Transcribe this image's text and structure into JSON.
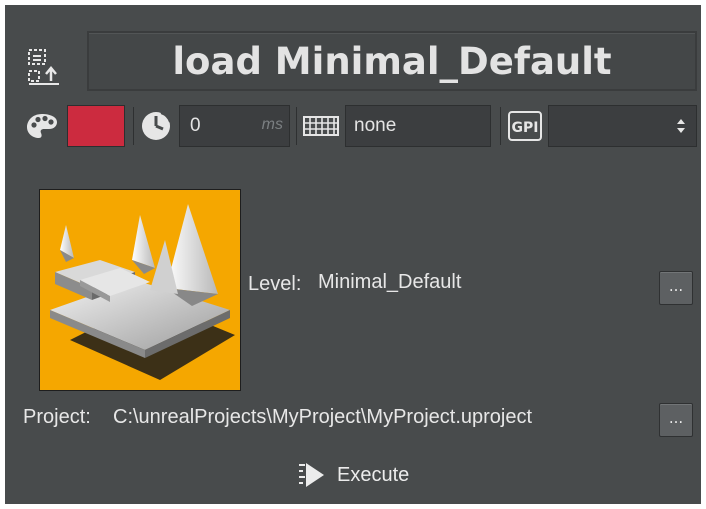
{
  "header": {
    "title": "load Minimal_Default",
    "title_icon": "load-scene-icon"
  },
  "toolbar": {
    "color_icon": "palette-icon",
    "color_value": "#cc2b3f",
    "delay_icon": "clock-icon",
    "delay_value": "0",
    "delay_unit": "ms",
    "layout_icon": "keyboard-icon",
    "layout_value": "none",
    "gpi_icon": "gpi-icon",
    "gpi_value": ""
  },
  "level": {
    "thumbnail_icon": "unreal-level-icon",
    "label": "Level:",
    "value": "Minimal_Default",
    "browse_label": "..."
  },
  "project": {
    "label": "Project:",
    "value": "C:\\unrealProjects\\MyProject\\MyProject.uproject",
    "browse_label": "..."
  },
  "execute": {
    "label": "Execute",
    "icon": "execute-icon"
  },
  "colors": {
    "panel": "#484b4c",
    "thumb_bg": "#f5a700",
    "accent_red": "#cc2b3f"
  }
}
